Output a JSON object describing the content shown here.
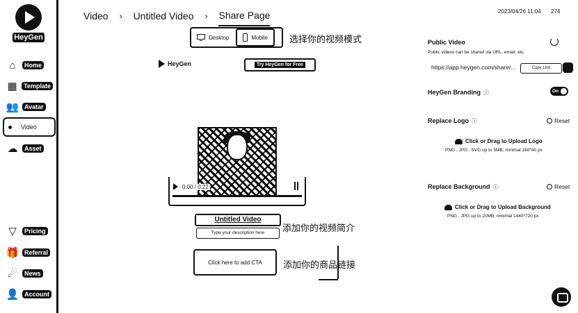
{
  "app": {
    "logo_text": "HeyGen"
  },
  "sidebar": {
    "items": [
      {
        "label": "Home",
        "icon": "home-icon",
        "glyph": "⌂"
      },
      {
        "label": "Template",
        "icon": "template-icon",
        "glyph": "▦"
      },
      {
        "label": "Avatar",
        "icon": "avatar-icon",
        "glyph": "👥"
      },
      {
        "label": "Video",
        "icon": "video-icon",
        "glyph": "•"
      },
      {
        "label": "Asset",
        "icon": "asset-icon",
        "glyph": "☁"
      }
    ],
    "bottom_items": [
      {
        "label": "Pricing",
        "icon": "pricing-icon",
        "glyph": "▽"
      },
      {
        "label": "Referral",
        "icon": "referral-icon",
        "glyph": "🎁"
      },
      {
        "label": "News",
        "icon": "news-icon",
        "glyph": "☄"
      },
      {
        "label": "Account",
        "icon": "account-icon",
        "glyph": "👤"
      }
    ]
  },
  "header": {
    "breadcrumb": [
      "Video",
      "Untitled Video",
      "Share Page"
    ],
    "separator": "›",
    "timestamp": "2023/04/26 11:04",
    "count": "274"
  },
  "mode_toggle": {
    "desktop": "Desktop",
    "mobile": "Mobile",
    "selected": "Desktop"
  },
  "annotations": {
    "mode": "选择你的视频模式",
    "intro": "添加你的视频简介",
    "link": "添加你的商品链接"
  },
  "preview": {
    "brand": "HeyGen",
    "try_button": "Try HeyGen for Free",
    "video_time": "0:00 / 0:22",
    "video_title": "Untitled Video",
    "description_placeholder": "Type your description here",
    "cta": "Click here to add CTA"
  },
  "right_panel": {
    "public_video_label": "Public Video",
    "public_video_desc": "Public videos can be shared via URL, email, etc.",
    "share_url": "https://app.heygen.com/share/...",
    "copy_text": "Copy Link",
    "branding_label": "HeyGen Branding",
    "branding_toggle": "On",
    "replace_logo_label": "Replace Logo",
    "reset_label": "Reset",
    "upload_logo": "Click or Drag to Upload Logo",
    "logo_hint": "PNG , JPG , SVG up to 5MB, minimal 160*40 px",
    "replace_bg_label": "Replace Background",
    "upload_bg": "Click or Drag to Upload Background",
    "bg_hint": "PNG , JPG up to 20MB, minimal 1440*720 px"
  },
  "colors": {
    "ink": "#111111",
    "background": "#ffffff"
  }
}
